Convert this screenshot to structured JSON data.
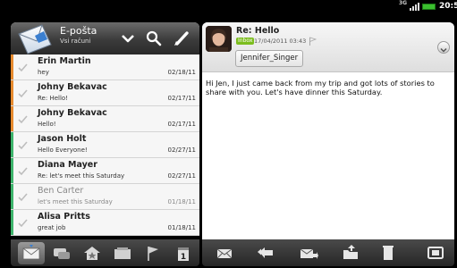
{
  "status_bar": {
    "network": "3G",
    "time": "20:5"
  },
  "mail_header": {
    "title": "E-pošta",
    "subtitle": "Vsi računi",
    "icons": [
      "envelope-app-icon",
      "chevron-down-icon",
      "search-icon",
      "compose-pencil-icon"
    ]
  },
  "messages": [
    {
      "sender": "Erin Martin",
      "subject": "hey",
      "date": "02/18/11",
      "bar_color": "#e68a2e",
      "read": false
    },
    {
      "sender": "Johny Bekavac",
      "subject": "Re: Hello!",
      "date": "02/17/11",
      "bar_color": "#e68a2e",
      "read": false
    },
    {
      "sender": "Johny Bekavac",
      "subject": "Hello!",
      "date": "02/17/11",
      "bar_color": "#e68a2e",
      "read": false
    },
    {
      "sender": "Jason Holt",
      "subject": "Hello Everyone!",
      "date": "02/27/11",
      "bar_color": "#3db36b",
      "read": false
    },
    {
      "sender": "Diana Mayer",
      "subject": "Re: let's meet this Saturday",
      "date": "02/27/11",
      "bar_color": "#3db36b",
      "read": false
    },
    {
      "sender": "Ben Carter",
      "subject": "let's meet this Saturday",
      "date": "01/18/11",
      "bar_color": "#3db36b",
      "read": true
    },
    {
      "sender": "Alisa Pritts",
      "subject": "great job",
      "date": "01/18/11",
      "bar_color": "#3db36b",
      "read": false
    }
  ],
  "tabs": [
    "inbox-tab-icon",
    "conversations-tab-icon",
    "favorites-tab-icon",
    "groups-tab-icon",
    "flagged-tab-icon",
    "calendar-tab-icon"
  ],
  "calendar_day": "1",
  "message": {
    "subject": "Re: Hello",
    "folder": "Inbox",
    "date": "17/04/2011 03:43",
    "sender": "Jennifer_Singer",
    "body": "Hi Jen, I just came back from my trip and got lots of stories to share with you. Let's have dinner this Saturday."
  },
  "actions": [
    "mark-unread-icon",
    "reply-all-icon",
    "forward-icon",
    "move-to-folder-icon",
    "delete-icon",
    "fullscreen-icon"
  ]
}
